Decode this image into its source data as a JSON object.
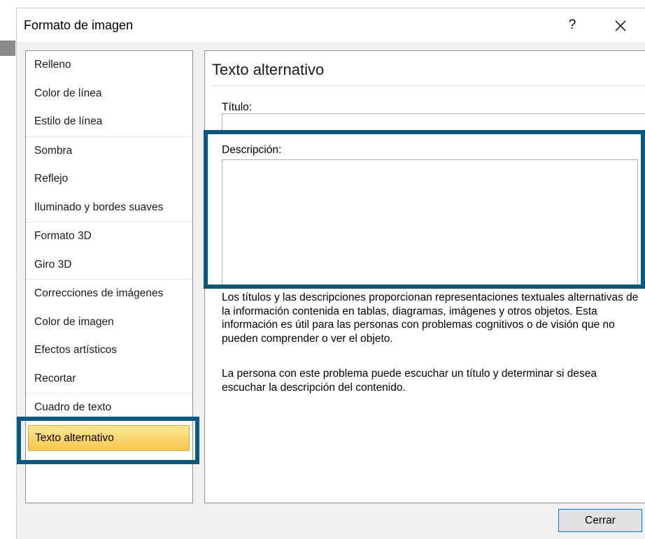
{
  "dialog": {
    "title": "Formato de imagen",
    "help_label": "?",
    "close_button_label": "Cerrar"
  },
  "nav": {
    "groups": [
      [
        {
          "label": "Relleno"
        },
        {
          "label": "Color de línea"
        },
        {
          "label": "Estilo de línea"
        }
      ],
      [
        {
          "label": "Sombra"
        },
        {
          "label": "Reflejo"
        },
        {
          "label": "Iluminado y bordes suaves"
        }
      ],
      [
        {
          "label": "Formato 3D"
        },
        {
          "label": "Giro 3D"
        }
      ],
      [
        {
          "label": "Correcciones de imágenes"
        },
        {
          "label": "Color de imagen"
        },
        {
          "label": "Efectos artísticos"
        },
        {
          "label": "Recortar"
        }
      ],
      [
        {
          "label": "Cuadro de texto"
        },
        {
          "label": "Texto alternativo",
          "selected": true
        }
      ]
    ]
  },
  "alt_text": {
    "heading": "Texto alternativo",
    "title_label": "Título:",
    "title_value": "",
    "description_label": "Descripción:",
    "description_value": "",
    "help_paragraph_1": "Los títulos y las descripciones proporcionan representaciones textuales alternativas de la información contenida en tablas, diagramas, imágenes y otros objetos. Esta información es útil para las personas con problemas cognitivos o de visión que no pueden comprender o ver el objeto.",
    "help_paragraph_2": "La persona con este problema puede escuchar un título y determinar si desea escuchar la descripción del contenido."
  },
  "colors": {
    "highlight": "#0b587e",
    "selected_item": "#f7c64c"
  }
}
